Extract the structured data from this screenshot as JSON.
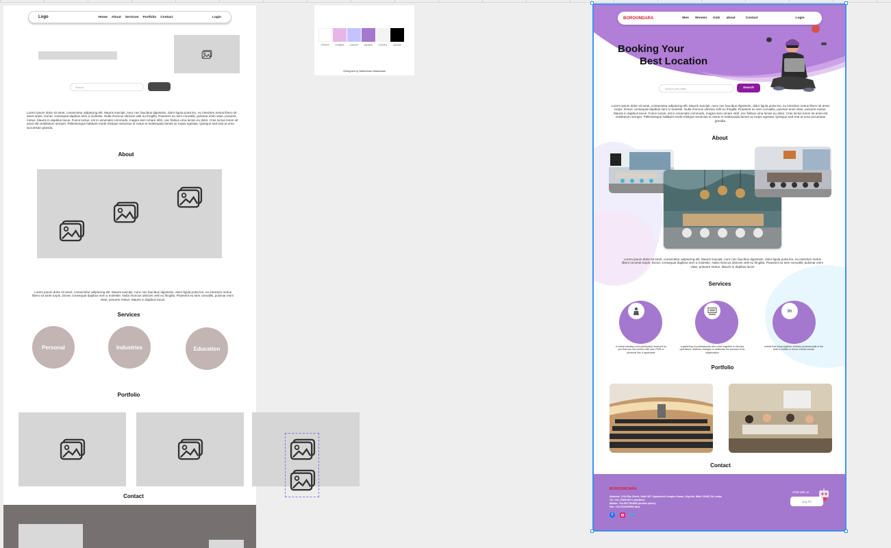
{
  "wireframe": {
    "logo": "Logo",
    "nav": [
      "Home",
      "About",
      "Services",
      "Portfolio",
      "Contact"
    ],
    "login": "Login",
    "search_placeholder": "Search",
    "intro_text": "Lorem ipsum dolor sit amet, consectetur adipiscing elit. Mauris suscipit, nunc nec faucibus dignissim, dolor ligula porta leo, eu interdum metus libero sit amet turpis. Donec consequat dapibus sem a molestie. Nulla rhoncus ultricies velit eu fringilla. Praesent eu sem convallis, pulvinar enim vitae, posuere metus. Mauris in dapibus lacus. Fusce luctus, est in venenatis commodo, magna sem ornare nibh, nec finibus urna lectus eu dolor. Cras luctus lorem sit amet elit vestibulum semper. Pellentesque habitant morbi tristique senectus et netus et malesuada fames ac turpis egestas. Quisque sed erat at urna accumsan gravida.",
    "about_title": "About",
    "about_text": "Lorem ipsum dolor sit amet, consectetur adipiscing elit. Mauris suscipit, nunc nec faucibus dignissim, dolor ligula porta leo, eu interdum metus libero sit amet turpis. Donec consequat dapibus sem a molestie. Nulla rhoncus ultricies velit eu fringilla. Praesent eu sem convallis, pulvinar enim vitae, posuere metus. Mauris in dapibus lacus.",
    "services_title": "Services",
    "services": [
      "Personal",
      "Industries",
      "Education"
    ],
    "portfolio_title": "Portfolio",
    "contact_title": "Contact"
  },
  "palette": {
    "colors": [
      {
        "hex": "#FFFFFF",
        "label": "FFFFFF"
      },
      {
        "hex": "#E7B6E8",
        "label": "E7B6E8"
      },
      {
        "hex": "#C5C3FF",
        "label": "C5C3FF"
      },
      {
        "hex": "#A578CF",
        "label": "A578CF"
      },
      {
        "hex": "#F3F3F3",
        "label": "F3F3F3"
      },
      {
        "hex": "#000000",
        "label": "000000"
      }
    ],
    "credit": "Designed by Malindhan Maamsala"
  },
  "design": {
    "brand": "BOROONDARA",
    "nav": [
      "Men",
      "Women",
      "Kids",
      "about",
      "Contact"
    ],
    "login": "Login",
    "hero_line1": "Booking Your",
    "hero_line2": "Best Location",
    "search_placeholder": "Search you place...",
    "search_button": "Search",
    "intro_text": "Lorem ipsum dolor sit amet, consectetur adipiscing elit. Mauris suscipit, nunc nec faucibus dignissim, dolor ligula porta leo, eu interdum metus libero sit amet turpis. Donec consequat dapibus sem a molestie. Nulla rhoncus ultricies velit eu fringilla. Praesent eu sem convallis, pulvinar enim vitae, posuere metus. Mauris in dapibus lacus. Fusce luctus, est in venenatis commodo, magna sem ornare nibh, nec finibus urna lectus eu dolor. Cras luctus lorem sit amet elit vestibulum semper. Pellentesque habitant morbi tristique senectus et netus et malesuada fames ac turpis egestas. Quisque sed erat at urna accumsan gravida.",
    "about_title": "About",
    "about_text": "Lorem ipsum dolor sit amet, consectetur adipiscing elit. Mauris suscipit, nunc nec faucibus dignissim, dolor ligula porta leo, eu interdum metus libero sit amet turpis. Donec consequat dapibus sem a molestie. Nulla rhoncus ultricies velit eu fringilla. Praesent eu sem convallis, pulvinar enim vitae, posuere metus. Mauris in dapibus lacus",
    "services_title": "Services",
    "services": [
      {
        "icon": "person-icon",
        "text": "A virtual meeting room particularly reserved for you that you can access with your PMR or personal link, if applicable"
      },
      {
        "icon": "conference-icon",
        "text": "a gathering of professionals who come together to discuss operations, address changes or celebrate the success of an organization"
      },
      {
        "icon": "linkedin-icon",
        "text": "events that bring together industry professionals in the field to mobile or these events include"
      }
    ],
    "portfolio_title": "Portfolio",
    "contact_title": "Contact",
    "footer": {
      "brand": "BOROONDARA",
      "address": "Address: 1234 Elm Street, Suite 567, Apartment Complex Name, Cityville, State 12345, Sri Lanka",
      "tel": "Tel: +20-1780876071 (landline)",
      "mobile": "Mobile: +20-9877964950 (mobile phone)",
      "fax": "Fax: +20-4700209956 (fax)",
      "chat_label": "Chat with us",
      "say_hi": "Say hi!"
    },
    "colors": {
      "purple": "#A578CF",
      "brand_red": "#D91B3A",
      "button": "#8B1A9E"
    }
  }
}
